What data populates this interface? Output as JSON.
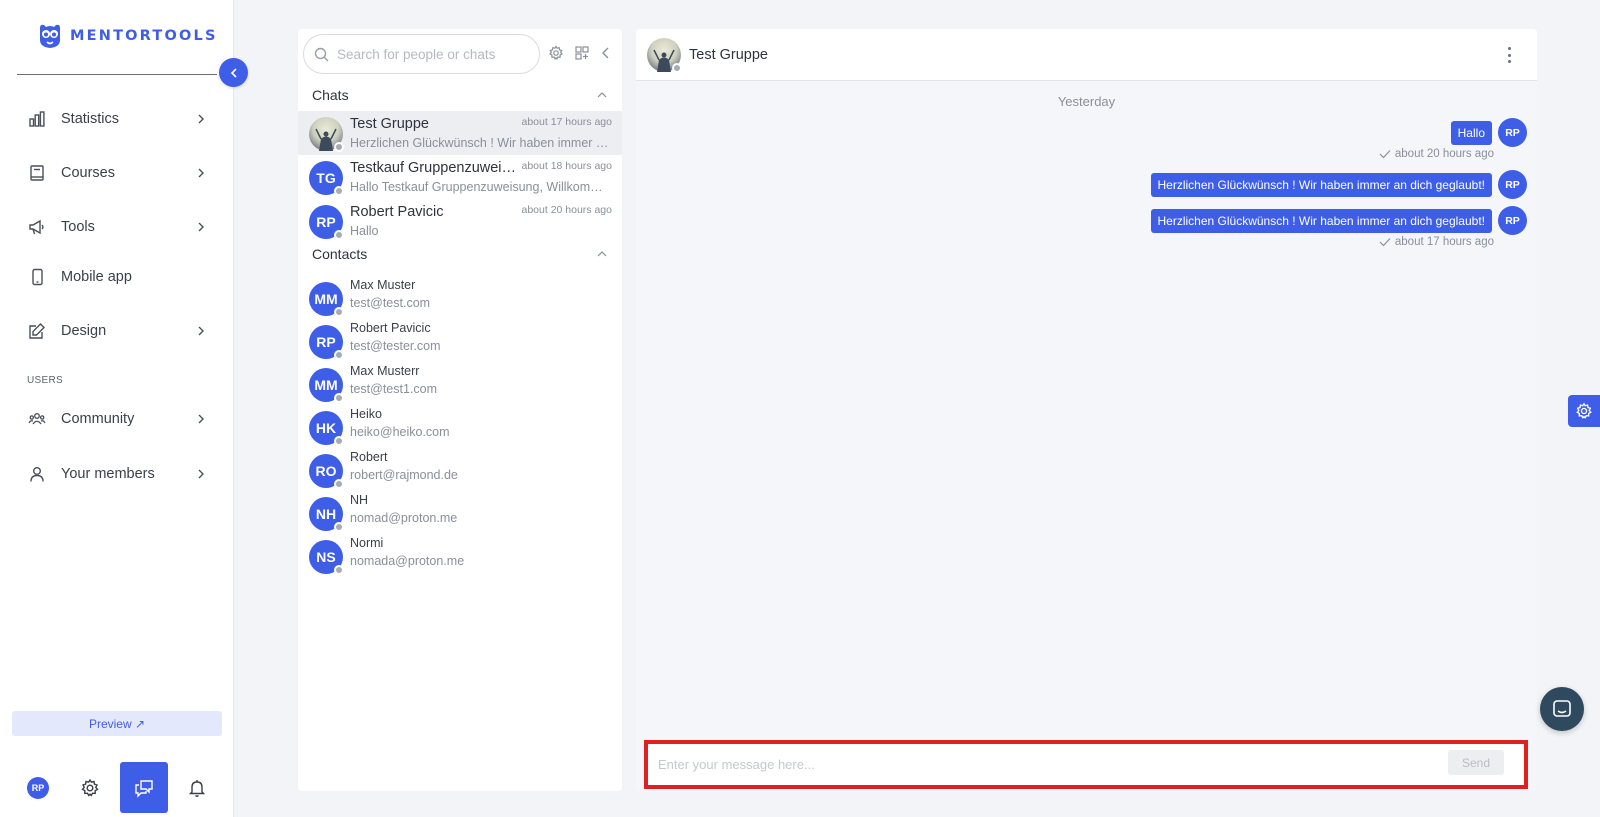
{
  "brand": {
    "name": "MENTORTOOLS",
    "color": "#3e5ee8"
  },
  "sidebar": {
    "items": [
      {
        "label": "Statistics",
        "icon": "bar-chart-icon",
        "has_submenu": true
      },
      {
        "label": "Courses",
        "icon": "book-icon",
        "has_submenu": true
      },
      {
        "label": "Tools",
        "icon": "megaphone-icon",
        "has_submenu": true
      },
      {
        "label": "Mobile app",
        "icon": "smartphone-icon",
        "has_submenu": false
      },
      {
        "label": "Design",
        "icon": "edit-icon",
        "has_submenu": true
      }
    ],
    "users_section_label": "USERS",
    "user_items": [
      {
        "label": "Community",
        "icon": "users-group-icon",
        "has_submenu": true
      },
      {
        "label": "Your members",
        "icon": "user-icon",
        "has_submenu": true
      }
    ],
    "preview_label": "Preview ↗",
    "bottom": {
      "avatar_initials": "RP"
    }
  },
  "chat_list": {
    "search_placeholder": "Search for people or chats",
    "chats_section": "Chats",
    "contacts_section": "Contacts",
    "chats": [
      {
        "name": "Test Gruppe",
        "time": "about 17 hours ago",
        "preview": "Herzlichen Glückwünsch ! Wir haben immer an dich geglaubt!",
        "initials": "",
        "photo": true,
        "active": true
      },
      {
        "name": "Testkauf Gruppenzuweisung",
        "time": "about 18 hours ago",
        "preview": "Hallo Testkauf Gruppenzuweisung, Willkommen!",
        "initials": "TG",
        "photo": false,
        "active": false
      },
      {
        "name": "Robert Pavicic",
        "time": "about 20 hours ago",
        "preview": "Hallo",
        "initials": "RP",
        "photo": false,
        "active": false
      }
    ],
    "contacts": [
      {
        "name": "Max Muster",
        "email": "test@test.com",
        "initials": "MM"
      },
      {
        "name": "Robert Pavicic",
        "email": "test@tester.com",
        "initials": "RP"
      },
      {
        "name": "Max Musterr",
        "email": "test@test1.com",
        "initials": "MM"
      },
      {
        "name": "Heiko",
        "email": "heiko@heiko.com",
        "initials": "HK"
      },
      {
        "name": "Robert",
        "email": "robert@rajmond.de",
        "initials": "RO"
      },
      {
        "name": "NH",
        "email": "nomad@proton.me",
        "initials": "NH"
      },
      {
        "name": "Normi",
        "email": "nomada@proton.me",
        "initials": "NS"
      }
    ]
  },
  "conversation": {
    "title": "Test Gruppe",
    "day_separator": "Yesterday",
    "messages": [
      {
        "text": "Hallo",
        "sender_initials": "RP",
        "meta": "about 20 hours ago"
      },
      {
        "text": "Herzlichen Glückwünsch ! Wir haben immer an dich geglaubt!",
        "sender_initials": "RP",
        "meta": ""
      },
      {
        "text": "Herzlichen Glückwünsch ! Wir haben immer an dich geglaubt!",
        "sender_initials": "RP",
        "meta": "about 17 hours ago"
      }
    ],
    "composer_placeholder": "Enter your message here...",
    "send_label": "Send"
  }
}
